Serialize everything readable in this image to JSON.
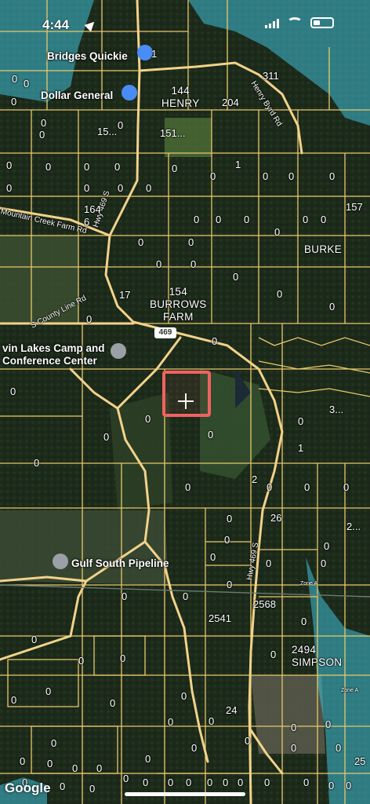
{
  "status": {
    "time": "4:44"
  },
  "attribution": "Google",
  "places": [
    {
      "name": "Bridges Quickie",
      "icon": "shopping-bag-icon",
      "color": "#4a8cf5"
    },
    {
      "name": "Dollar General",
      "icon": "shopping-basket-icon",
      "color": "#4a8cf5"
    },
    {
      "name": "vin Lakes Camp and\nConference Center",
      "icon": "map-pin-icon",
      "color": "#9aa0a6"
    },
    {
      "name": "Gulf South Pipeline",
      "icon": "map-pin-icon",
      "color": "#9aa0a6"
    }
  ],
  "roads": {
    "hwy_shield": "469",
    "labels": [
      "Mountain Creek Farm Rd",
      "Hwy 469 S",
      "S County Line Rd",
      "Henry Byrd Rd",
      "Hwy 469 S"
    ]
  },
  "parcels": {
    "owners": [
      "144\nHENRY",
      "154\nBURROWS\nFARM",
      "BURKE",
      "2494\nSIMPSON"
    ],
    "values": [
      "0",
      "0",
      "0",
      "0",
      "0",
      "0",
      "0",
      "0",
      "0",
      "0",
      "0",
      "0",
      "0",
      "0",
      "0",
      "0",
      "0",
      "0",
      "0",
      "0",
      "0",
      "0",
      "0",
      "0",
      "0",
      "0",
      "0",
      "0",
      "0",
      "0",
      "0",
      "0",
      "0",
      "0",
      "0",
      "0",
      "0",
      "0",
      "0",
      "0",
      "0",
      "0",
      "0",
      "0",
      "0",
      "0",
      "0",
      "0",
      "0",
      "0",
      "0",
      "0",
      "0",
      "0",
      "0",
      "0",
      "0",
      "0",
      "0",
      "0",
      "0",
      "0",
      "0",
      "0",
      "0",
      "0",
      "0",
      "0",
      "0",
      "0",
      "0",
      "0",
      "0",
      "0",
      "0",
      "0",
      "0",
      "0",
      "0",
      "0",
      "0",
      "0",
      "0",
      "0",
      "0",
      "0",
      "0",
      "0",
      "0",
      "0",
      "0",
      "0",
      "0",
      "0",
      "0",
      "0",
      "0",
      "0",
      "0"
    ],
    "numbers": [
      "311",
      "204",
      "15...",
      "151...",
      "1",
      "157",
      "164\n6",
      "17",
      "3...",
      "1",
      "2",
      "26",
      "2...",
      "2568",
      "2541",
      "24",
      "25",
      "1"
    ]
  },
  "flood_zone": {
    "labels": [
      "Zone A",
      "Zone A"
    ],
    "color": "#3fc0d8"
  },
  "selection": {
    "color": "#f06262"
  }
}
